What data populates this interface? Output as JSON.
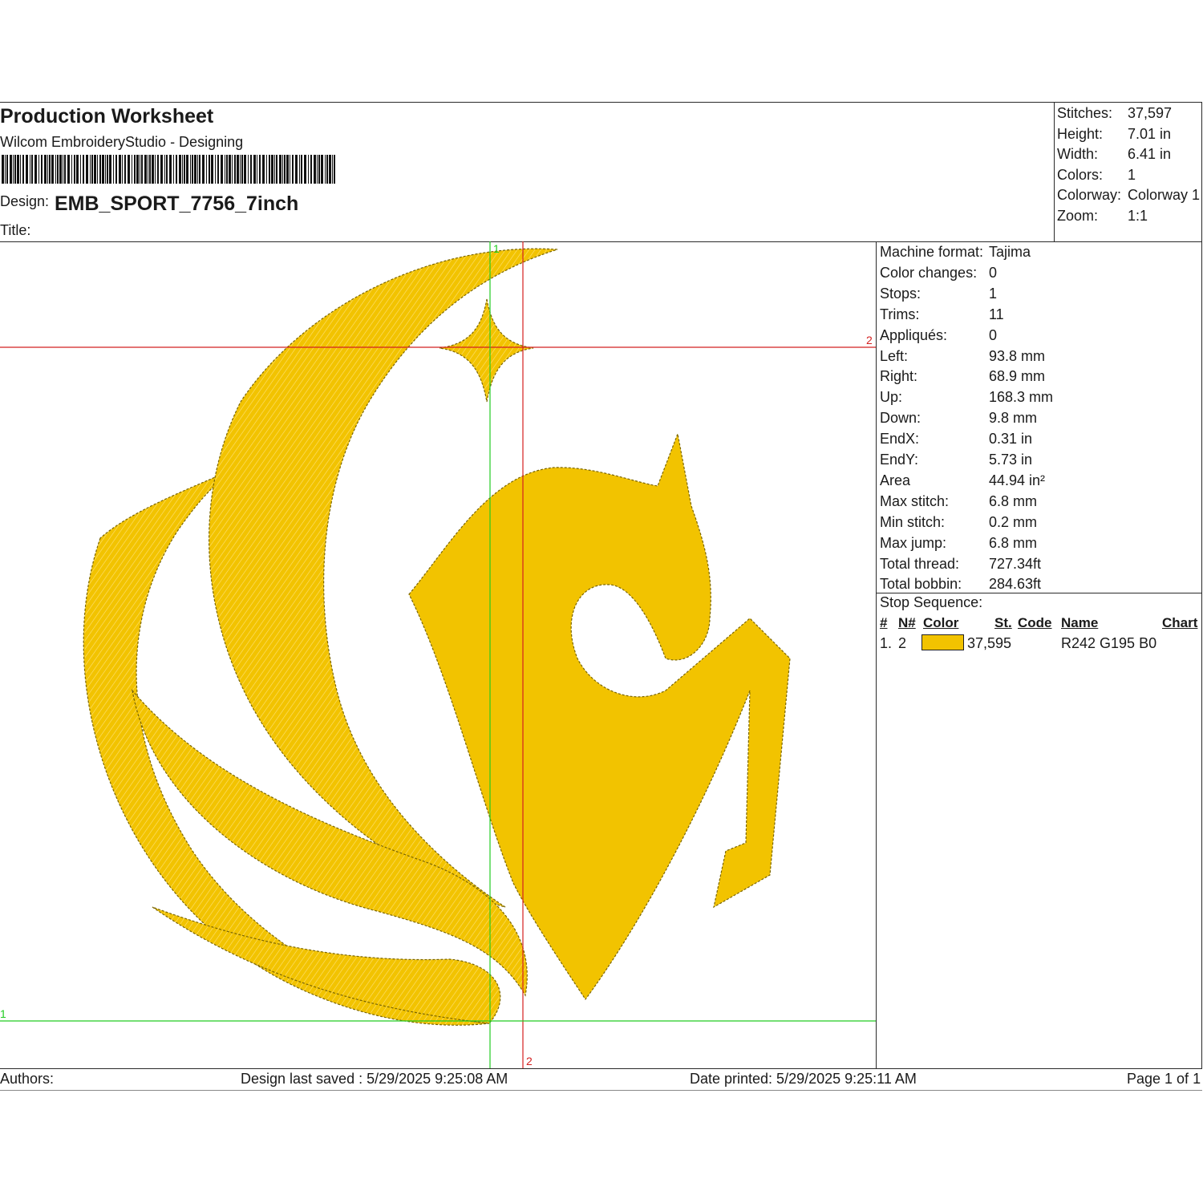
{
  "header": {
    "title": "Production Worksheet",
    "subtitle": "Wilcom EmbroideryStudio - Designing",
    "design_label": "Design:",
    "design_value": "EMB_SPORT_7756_7inch",
    "title_label": "Title:"
  },
  "summary": [
    {
      "label": "Stitches:",
      "value": "37,597"
    },
    {
      "label": "Height:",
      "value": "7.01 in"
    },
    {
      "label": "Width:",
      "value": "6.41 in"
    },
    {
      "label": "Colors:",
      "value": "1"
    },
    {
      "label": "Colorway:",
      "value": "Colorway 1"
    },
    {
      "label": "Zoom:",
      "value": "1:1"
    }
  ],
  "details": [
    {
      "label": "Machine format:",
      "value": "Tajima"
    },
    {
      "label": "Color changes:",
      "value": "0"
    },
    {
      "label": "Stops:",
      "value": "1"
    },
    {
      "label": "Trims:",
      "value": "11"
    },
    {
      "label": "Appliqués:",
      "value": "0"
    },
    {
      "label": "Left:",
      "value": "93.8 mm"
    },
    {
      "label": "Right:",
      "value": "68.9 mm"
    },
    {
      "label": "Up:",
      "value": "168.3 mm"
    },
    {
      "label": "Down:",
      "value": "9.8 mm"
    },
    {
      "label": "EndX:",
      "value": "0.31 in"
    },
    {
      "label": "EndY:",
      "value": "5.73 in"
    },
    {
      "label": "Area",
      "value": " 44.94 in²"
    },
    {
      "label": "Max stitch:",
      "value": "6.8 mm"
    },
    {
      "label": "Min stitch:",
      "value": "0.2 mm"
    },
    {
      "label": "Max jump:",
      "value": "6.8 mm"
    },
    {
      "label": "Total thread:",
      "value": "727.34ft"
    },
    {
      "label": "Total bobbin:",
      "value": "284.63ft"
    }
  ],
  "stop_sequence": {
    "label": "Stop Sequence:",
    "headers": {
      "num": "#",
      "n": "N#",
      "color": "Color",
      "st": "St.",
      "code": "Code",
      "name": "Name",
      "chart": "Chart"
    },
    "rows": [
      {
        "num": "1.",
        "n": "2",
        "swatch": "#F2C300",
        "stitches": "37,595",
        "code": "",
        "name": "R242 G195 B0",
        "chart": ""
      }
    ]
  },
  "canvas_markers": {
    "red_h": "2",
    "red_v": "2",
    "green_h": "1",
    "green_v": "1"
  },
  "footer": {
    "authors": "Authors:",
    "saved": "Design last saved : 5/29/2025 9:25:08 AM",
    "printed": "Date printed: 5/29/2025 9:25:11 AM",
    "page": "Page 1 of 1"
  },
  "colors": {
    "thread": "#F2C300",
    "thread_dark": "#C89A00",
    "guide_red": "#D42020",
    "guide_green": "#22CC22"
  }
}
